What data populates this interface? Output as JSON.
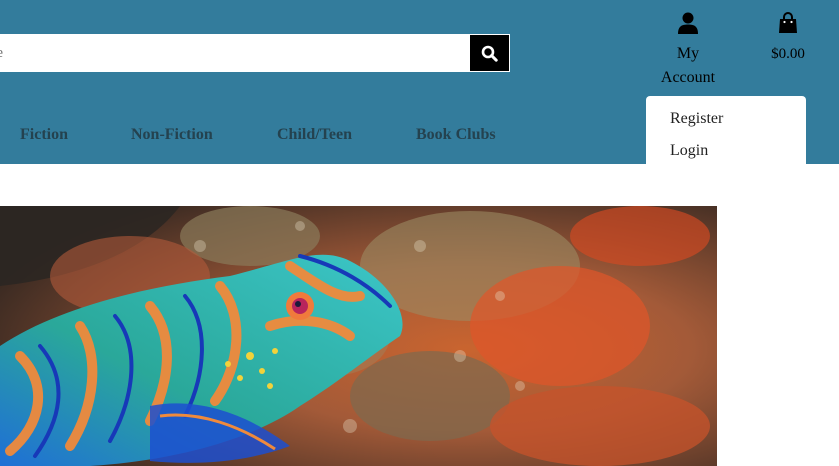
{
  "search": {
    "placeholder": "ite"
  },
  "account": {
    "label_line1": "My",
    "label_line2": "Account",
    "icon": "user-icon"
  },
  "bag": {
    "total": "$0.00",
    "icon": "shopping-bag-icon"
  },
  "nav": {
    "items": [
      {
        "label": "Fiction"
      },
      {
        "label": "Non-Fiction"
      },
      {
        "label": "Child/Teen"
      },
      {
        "label": "Book Clubs"
      }
    ]
  },
  "account_menu": {
    "items": [
      {
        "label": "Register"
      },
      {
        "label": "Login"
      }
    ]
  },
  "colors": {
    "header_bg": "#337c9c",
    "nav_text": "#24424f",
    "search_button_bg": "#000000"
  },
  "hero": {
    "image": "mandarin-fish-on-coral-reef"
  }
}
